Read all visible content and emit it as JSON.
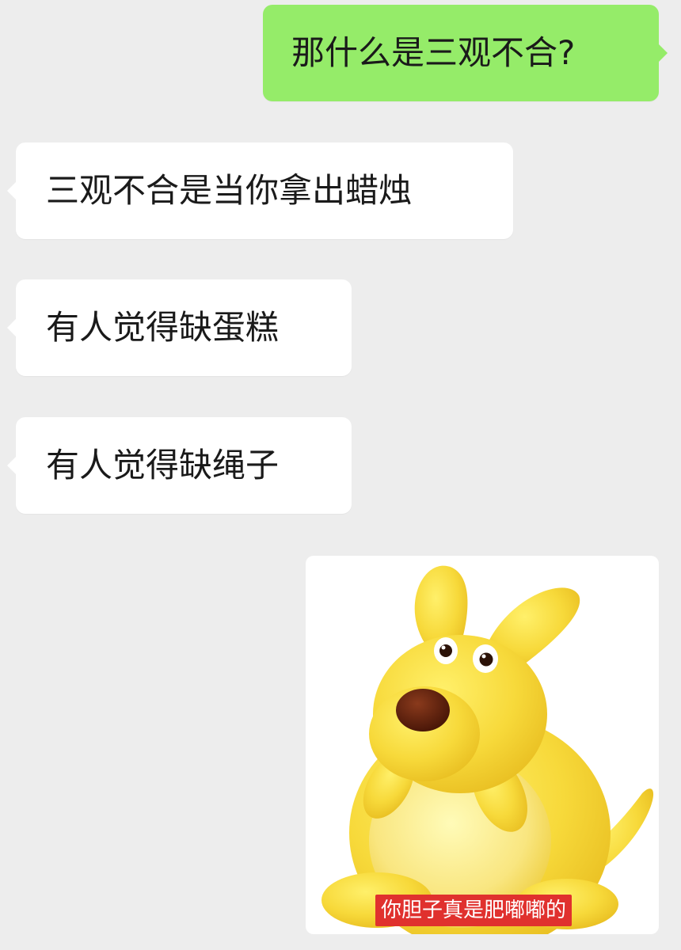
{
  "messages": [
    {
      "direction": "outgoing",
      "text": "那什么是三观不合?"
    },
    {
      "direction": "incoming",
      "text": "三观不合是当你拿出蜡烛"
    },
    {
      "direction": "incoming",
      "text": "有人觉得缺蛋糕"
    },
    {
      "direction": "incoming",
      "text": "有人觉得缺绳子"
    }
  ],
  "sticker": {
    "subject": "yellow-clay-kangaroo",
    "caption": "你胆子真是肥嘟嘟的"
  },
  "colors": {
    "background": "#ededed",
    "outgoing_bubble": "#95ec69",
    "incoming_bubble": "#ffffff",
    "caption_bg": "#e0312e"
  }
}
